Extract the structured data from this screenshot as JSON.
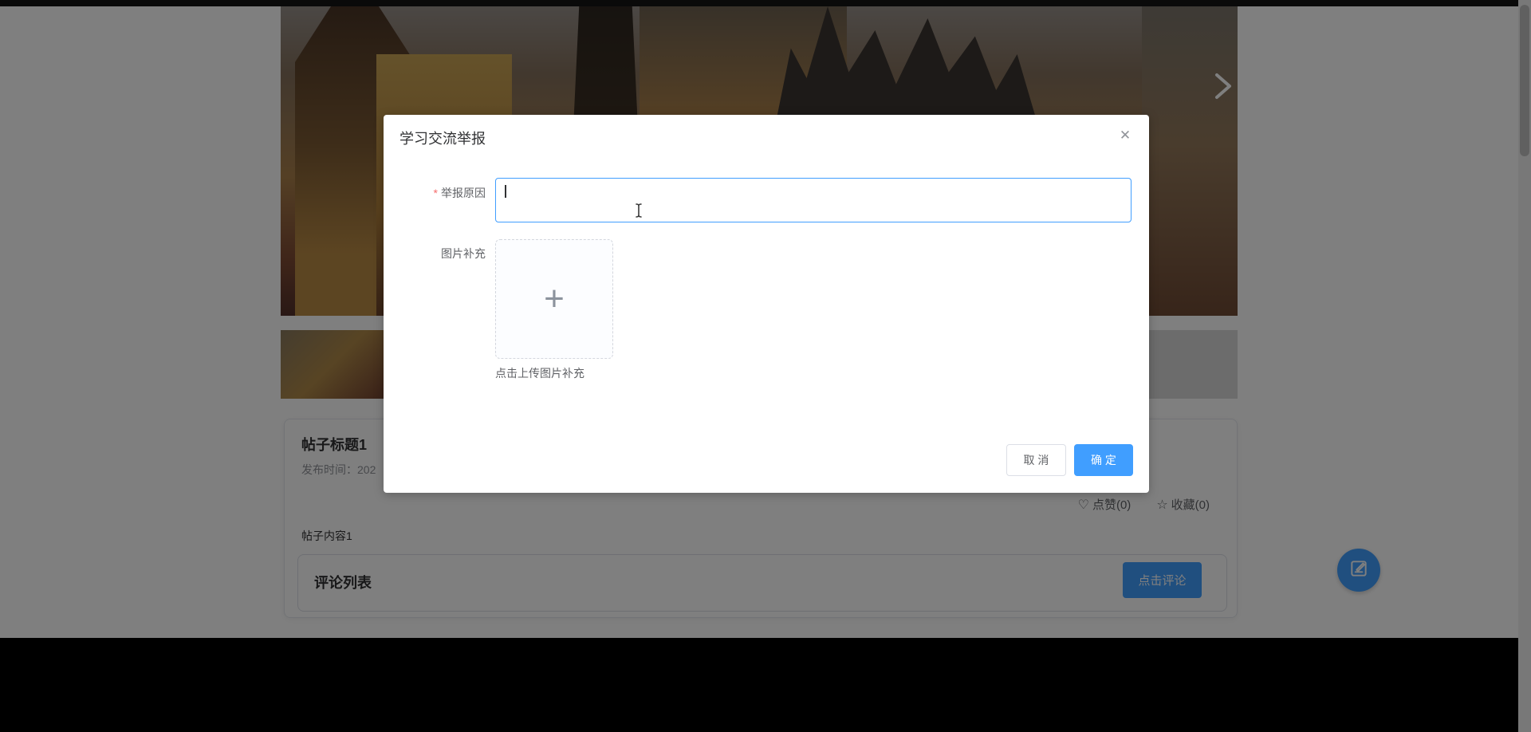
{
  "colors": {
    "primary": "#409EFF",
    "danger_asterisk": "#f56c6c",
    "text_primary": "#303133",
    "text_secondary": "#606266",
    "text_muted": "#909399"
  },
  "carousel": {
    "next_arrow_icon": "❯"
  },
  "post": {
    "title": "帖子标题1",
    "publish_time": "发布时间：202",
    "like_icon": "♡",
    "like_label": "点赞(0)",
    "favorite_icon": "☆",
    "favorite_label": "收藏(0)",
    "content": "帖子内容1",
    "comments": {
      "title": "评论列表",
      "comment_button_label": "点击评论"
    }
  },
  "modal": {
    "title": "学习交流举报",
    "close_icon": "✕",
    "form": {
      "required_mark": "*",
      "reason_label": "举报原因",
      "reason_value": "",
      "image_label": "图片补充",
      "upload_plus_icon": "+",
      "upload_hint": "点击上传图片补充"
    },
    "footer": {
      "cancel_label": "取 消",
      "confirm_label": "确 定"
    }
  }
}
